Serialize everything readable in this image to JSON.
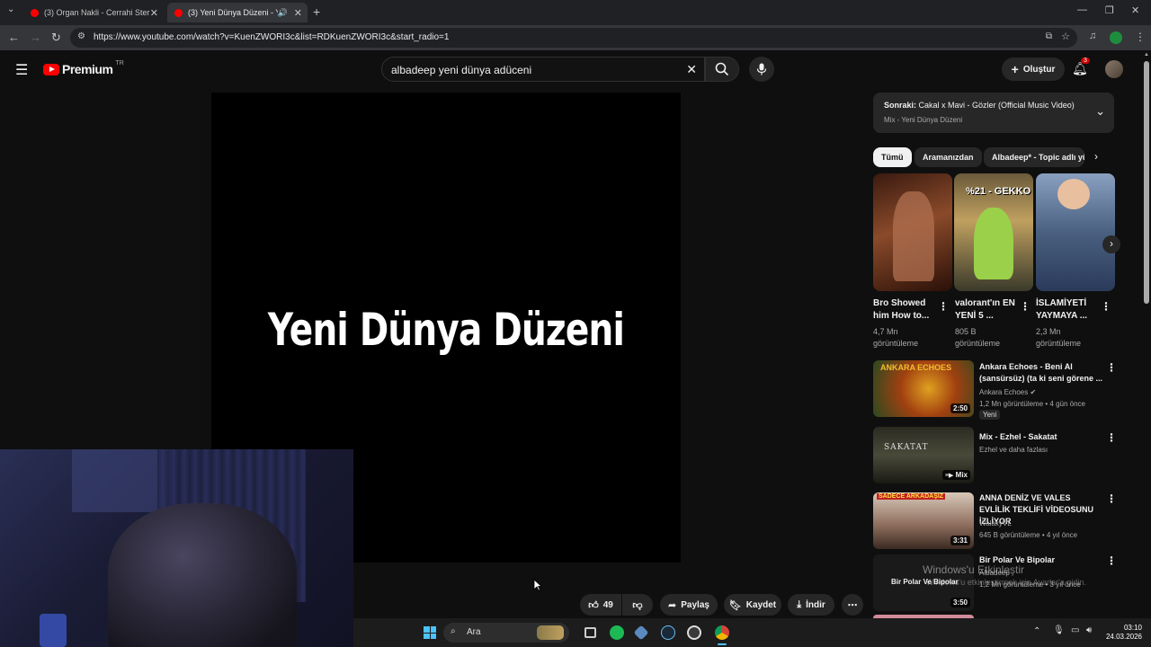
{
  "browser": {
    "tabs": [
      {
        "title": "(3) Organ Nakli - Cerrahi Steril",
        "active": false
      },
      {
        "title": "(3) Yeni Dünya Düzeni - You",
        "active": true
      }
    ],
    "new_tab_label": "+",
    "url": "https://www.youtube.com/watch?v=KuenZWORI3c&list=RDKuenZWORI3c&start_radio=1"
  },
  "header": {
    "logo_text": "Premium",
    "region": "TR",
    "search_query": "albadeep yeni dünya adüceni",
    "create_label": "Oluştur",
    "notifications_count": "3"
  },
  "video": {
    "overlay_text": "Yeni Dünya Düzeni",
    "like_count": "49",
    "share_label": "Paylaş",
    "save_label": "Kaydet",
    "download_label": "İndir"
  },
  "upnext": {
    "prefix": "Sonraki:",
    "title": "Cakal x Mavi - Gözler (Official Music Video)",
    "subtitle": "Mix - Yeni Dünya Düzeni"
  },
  "chips": [
    {
      "label": "Tümü",
      "active": true
    },
    {
      "label": "Aramanızdan",
      "active": false
    },
    {
      "label": "Albadeep* - Topic adlı yü",
      "active": false
    }
  ],
  "shorts": [
    {
      "title": "Bro Showed him How to...",
      "views": "4,7 Mn görüntüleme",
      "thumb_text": ""
    },
    {
      "title": "valorant'ın EN YENİ 5 ...",
      "views": "805 B görüntüleme",
      "thumb_text": "%21 - GEKKO"
    },
    {
      "title": "İSLAMİYETİ YAYMAYA ...",
      "views": "2,3 Mn görüntüleme",
      "thumb_text": ""
    }
  ],
  "videos": [
    {
      "title": "Ankara Echoes - Beni Al (sansürsüz) (ta ki seni görene ...",
      "channel": "Ankara Echoes",
      "meta": "1,2 Mn görüntüleme • 4 gün önce",
      "badge": "Yeni",
      "duration": "2:50",
      "thumb_text": "ANKARA ECHOES"
    },
    {
      "title": "Mix - Ezhel - Sakatat",
      "channel": "Ezhel ve daha fazlası",
      "meta": "",
      "badge": "",
      "duration": "Mix",
      "thumb_text": "SAKATAT"
    },
    {
      "title": "ANNA DENİZ VE VALES EVLİLİK TEKLİFİ VİDEOSUNU İZLİYOR",
      "channel": "WalaxyVL",
      "meta": "645 B görüntüleme • 4 yıl önce",
      "badge": "",
      "duration": "3:31",
      "thumb_text": "SADECE ARKADAŞIZ"
    },
    {
      "title": "Bir Polar Ve Bipolar",
      "channel": "Albadeep",
      "meta": "1,2 Mn görüntüleme • 3 yıl önce",
      "badge": "",
      "duration": "3:50",
      "thumb_text": "Bir Polar Ve Bipolar"
    }
  ],
  "watermark": {
    "line1": "Windows'u Etkinleştir",
    "line2": "Windows'u etkinleştirmek için Ayarlar'a gidin."
  },
  "taskbar": {
    "search_label": "Ara",
    "time": "03:10",
    "date": "24.03.2026"
  },
  "colors": {
    "youtube_red": "#ff0000",
    "background": "#0f0f0f",
    "chip_bg": "#272727"
  }
}
